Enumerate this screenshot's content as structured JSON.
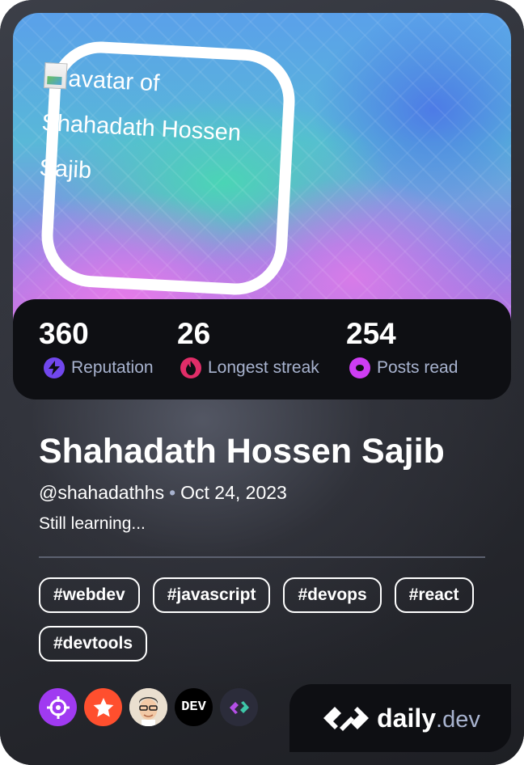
{
  "avatar": {
    "alt_text": "avatar of Shahadath Hossen Sajib"
  },
  "stats": [
    {
      "value": "360",
      "label": "Reputation",
      "icon": "lightning-icon",
      "color": "#7147ed"
    },
    {
      "value": "26",
      "label": "Longest streak",
      "icon": "flame-icon",
      "color": "#e12d68"
    },
    {
      "value": "254",
      "label": "Posts read",
      "icon": "eye-icon",
      "color": "#ce3df3"
    }
  ],
  "profile": {
    "name": "Shahadath Hossen Sajib",
    "handle": "@shahadathhs",
    "separator": "•",
    "joined": "Oct 24, 2023",
    "bio": "Still learning..."
  },
  "tags": [
    "#webdev",
    "#javascript",
    "#devops",
    "#react",
    "#devtools"
  ],
  "badges": [
    {
      "icon": "crosshair-icon",
      "color": "#a03af1"
    },
    {
      "icon": "star-icon",
      "color": "#ff4f2e"
    },
    {
      "icon": "memoji-avatar-icon",
      "color": "#f1e6d8"
    },
    {
      "icon": "dev-logo-icon",
      "label": "DEV",
      "color": "#000000"
    },
    {
      "icon": "dailydev-logo-icon",
      "color": "#2b2c3a"
    }
  ],
  "brand": {
    "name": "daily",
    "suffix": ".dev"
  },
  "colors": {
    "card_background": "#2a2c33",
    "stats_background": "#0e0f13",
    "label_secondary": "#a8b3cf"
  }
}
